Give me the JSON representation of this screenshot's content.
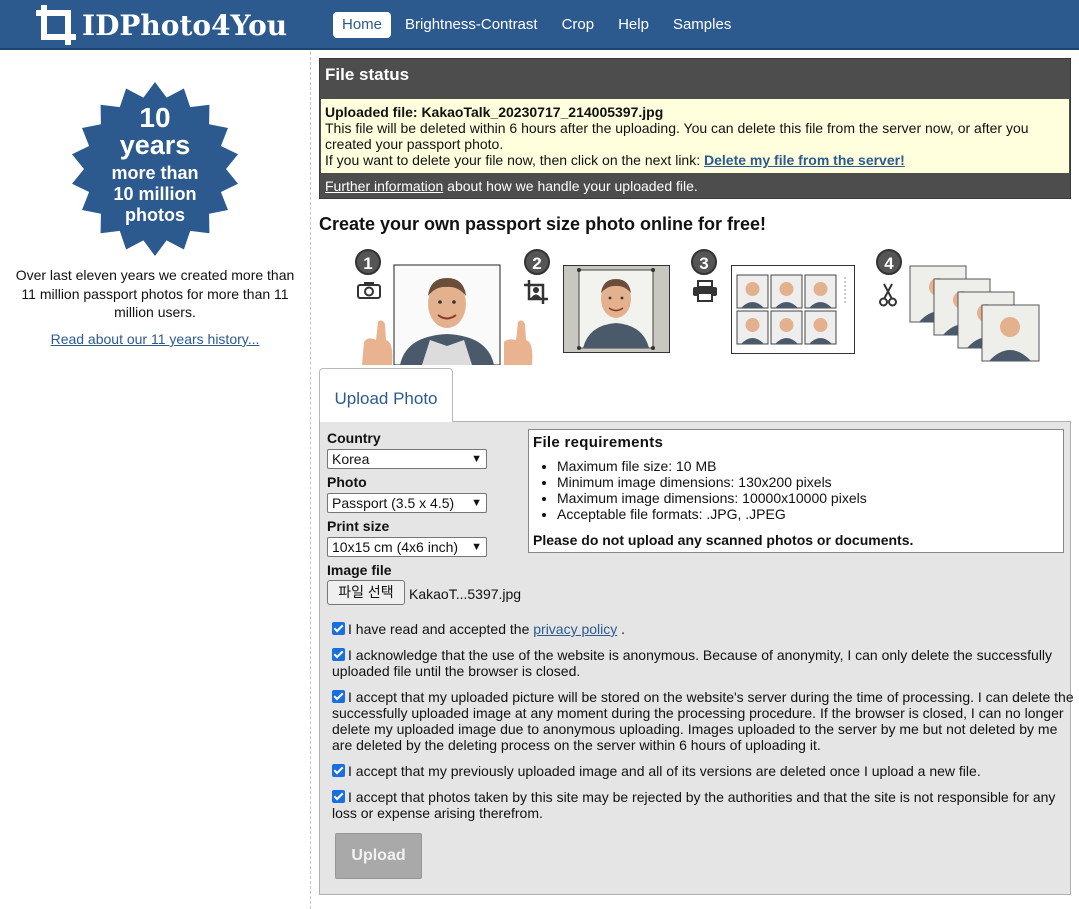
{
  "brand": {
    "name": "IDPhoto4You"
  },
  "nav": {
    "items": [
      {
        "label": "Home",
        "active": true
      },
      {
        "label": "Brightness-Contrast"
      },
      {
        "label": "Crop"
      },
      {
        "label": "Help"
      },
      {
        "label": "Samples"
      }
    ]
  },
  "sidebar": {
    "badge": {
      "line1": "10",
      "line2": "years",
      "line3": "more than",
      "line4": "10 million",
      "line5": "photos"
    },
    "text": "Over last eleven years we created more than 11 million passport photos for more than 11 million users.",
    "link": "Read about our 11 years history..."
  },
  "file_status": {
    "title": "File status",
    "uploaded_label": "Uploaded file: KakaoTalk_20230717_214005397.jpg",
    "line1": "This file will be deleted within 6 hours after the uploading. You can delete this file from the server now, or after you created your passport photo.",
    "line2": "If you want to delete your file now, then click on the next link: ",
    "delete_link": "Delete my file from the server!",
    "further_link": "Further information",
    "further_text": " about how we handle your uploaded file."
  },
  "headline": "Create your own passport size photo online for free!",
  "steps": [
    "1",
    "2",
    "3",
    "4"
  ],
  "tab": {
    "label": "Upload Photo"
  },
  "form": {
    "country": {
      "label": "Country",
      "value": "Korea"
    },
    "photo": {
      "label": "Photo",
      "value": "Passport (3.5 x 4.5)"
    },
    "print_size": {
      "label": "Print size",
      "value": "10x15 cm (4x6 inch)"
    },
    "image_file": {
      "label": "Image file",
      "button": "파일 선택",
      "filename": "KakaoT...5397.jpg"
    }
  },
  "requirements": {
    "title": "File requirements",
    "items": [
      "Maximum file size: 10 MB",
      "Minimum image dimensions: 130x200 pixels",
      "Maximum image dimensions: 10000x10000 pixels",
      "Acceptable file formats: .JPG, .JPEG"
    ],
    "warning": "Please do not upload any scanned photos or documents."
  },
  "consents": [
    {
      "text_before": "I have read and accepted the ",
      "link": "privacy policy",
      "text_after": " .",
      "checked": true
    },
    {
      "text": "I acknowledge that the use of the website is anonymous. Because of anonymity, I can only delete the successfully uploaded file until the browser is closed.",
      "checked": true
    },
    {
      "text": "I accept that my uploaded picture will be stored on the website's server during the time of processing. I can delete the successfully uploaded image at any moment during the processing procedure. If the browser is closed, I can no longer delete my uploaded image due to anonymous uploading. Images uploaded to the server by me but not deleted by me are deleted by the deleting process on the server within 6 hours of uploading it.",
      "checked": true
    },
    {
      "text": "I accept that my previously uploaded image and all of its versions are deleted once I upload a new file.",
      "checked": true
    },
    {
      "text": "I accept that photos taken by this site may be rejected by the authorities and that the site is not responsible for any loss or expense arising therefrom.",
      "checked": true
    }
  ],
  "upload_button": "Upload",
  "colors": {
    "brand": "#2c5a8e",
    "status_bg": "#4d4d4d",
    "notice_bg": "#ffffdd",
    "panel_bg": "#e5e5e5"
  }
}
